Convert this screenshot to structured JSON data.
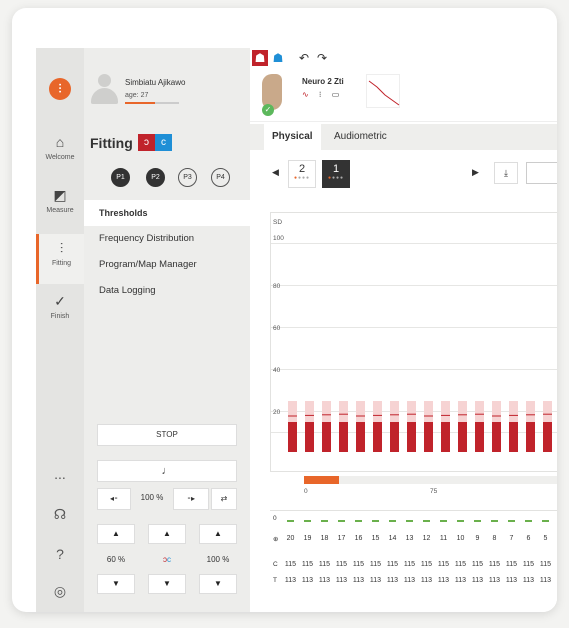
{
  "rail": {
    "items": [
      {
        "label": "Welcome",
        "icon": "home-icon"
      },
      {
        "label": "Measure",
        "icon": "measure-icon"
      },
      {
        "label": "Fitting",
        "icon": "sliders-icon"
      },
      {
        "label": "Finish",
        "icon": "check-icon"
      }
    ],
    "active": "Fitting",
    "more": "...",
    "help": "?"
  },
  "patient": {
    "name": "Simbiatu Ajikawo",
    "age": "age: 27"
  },
  "fitting": {
    "title": "Fitting",
    "programs": [
      "P1",
      "P2",
      "P3",
      "P4"
    ],
    "menu": [
      "Thresholds",
      "Frequency Distribution",
      "Program/Map Manager",
      "Data Logging"
    ],
    "active_menu": "Thresholds",
    "stop_label": "STOP",
    "note_glyph": "♩",
    "volume_percent": "100 %",
    "left_level": "60 %",
    "right_level": "100 %"
  },
  "device": {
    "name": "Neuro 2 Zti"
  },
  "tabs": [
    "Physical",
    "Audiometric"
  ],
  "active_tab": "Physical",
  "selector": {
    "left_card": "2",
    "right_card": "1"
  },
  "chart": {
    "sd_label": "SD",
    "y_ticks": [
      "100",
      "80",
      "60",
      "40",
      "20"
    ],
    "x_scale": [
      "0",
      "75"
    ]
  },
  "chart_data": {
    "type": "bar",
    "title": "",
    "ylim": [
      0,
      100
    ],
    "electrodes": [
      20,
      19,
      18,
      17,
      16,
      15,
      14,
      13,
      12,
      11,
      10,
      9,
      8,
      7,
      6,
      5
    ],
    "series": [
      {
        "name": "C",
        "values": [
          115,
          115,
          115,
          115,
          115,
          115,
          115,
          115,
          115,
          115,
          115,
          115,
          115,
          115,
          115,
          115
        ]
      },
      {
        "name": "T",
        "values": [
          113,
          113,
          113,
          113,
          113,
          113,
          113,
          113,
          113,
          113,
          113,
          113,
          113,
          113,
          113,
          113
        ]
      }
    ]
  },
  "table": {
    "row0_label": "0",
    "c_label": "C",
    "t_label": "T",
    "electrodes": [
      "20",
      "19",
      "18",
      "17",
      "16",
      "15",
      "14",
      "13",
      "12",
      "11",
      "10",
      "9",
      "8",
      "7",
      "6",
      "5"
    ],
    "c_values": [
      "115",
      "115",
      "115",
      "115",
      "115",
      "115",
      "115",
      "115",
      "115",
      "115",
      "115",
      "115",
      "115",
      "115",
      "115",
      "115"
    ],
    "t_values": [
      "113",
      "113",
      "113",
      "113",
      "113",
      "113",
      "113",
      "113",
      "113",
      "113",
      "113",
      "113",
      "113",
      "113",
      "113",
      "113"
    ]
  },
  "colors": {
    "accent": "#e8662a",
    "bar_dark": "#c0232b",
    "bar_light": "#f6d3d3",
    "ear_left": "#c0232b",
    "ear_right": "#1f8fd6"
  }
}
